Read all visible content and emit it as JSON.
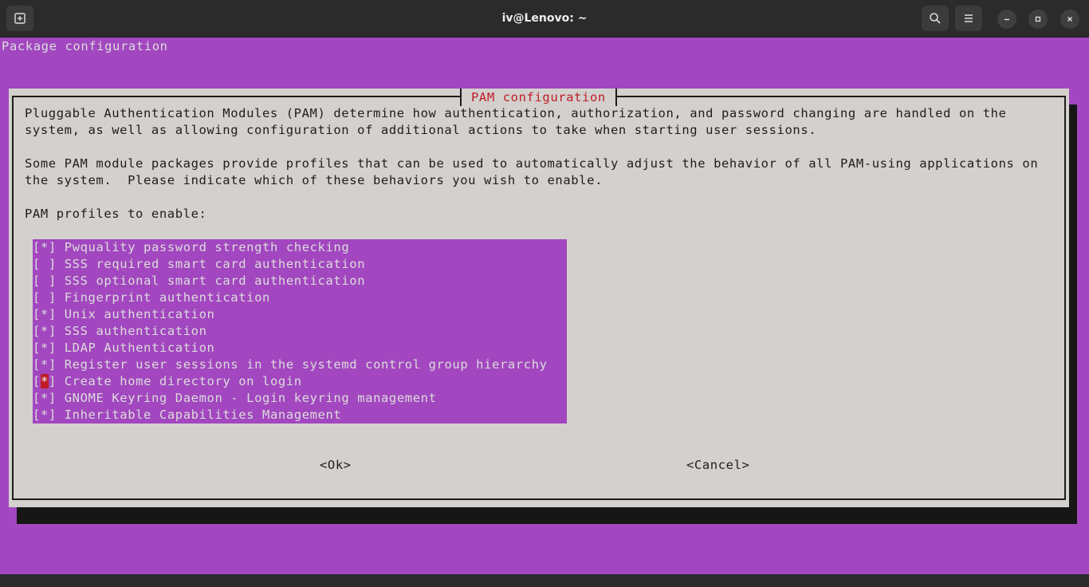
{
  "window": {
    "title": "iv@Lenovo: ~",
    "icons": [
      "new-tab-icon",
      "search-icon",
      "hamburger-menu-icon",
      "minimize-icon",
      "maximize-icon",
      "close-icon"
    ]
  },
  "terminal": {
    "header": "Package configuration",
    "colors": {
      "background": "#a247bf",
      "dialog": "#d3d0cd",
      "title": "#c01c28",
      "cursor": "#c01c28"
    }
  },
  "dialog": {
    "title": "PAM configuration",
    "para1_line1": "Pluggable Authentication Modules (PAM) determine how authentication, authorization, and password changing are handled on the",
    "para1_line2": "system, as well as allowing configuration of additional actions to take when starting user sessions.",
    "para2_line1": "Some PAM module packages provide profiles that can be used to automatically adjust the behavior of all PAM-using applications on",
    "para2_line2": "the system.  Please indicate which of these behaviors you wish to enable.",
    "prompt": "PAM profiles to enable:",
    "items": [
      {
        "label": "Pwquality password strength checking",
        "checked": true
      },
      {
        "label": "SSS required smart card authentication",
        "checked": false
      },
      {
        "label": "SSS optional smart card authentication",
        "checked": false
      },
      {
        "label": "Fingerprint authentication",
        "checked": false
      },
      {
        "label": "Unix authentication",
        "checked": true
      },
      {
        "label": "SSS authentication",
        "checked": true
      },
      {
        "label": "LDAP Authentication",
        "checked": true
      },
      {
        "label": "Register user sessions in the systemd control group hierarchy",
        "checked": true
      },
      {
        "label": "Create home directory on login",
        "checked": true,
        "cursor": true
      },
      {
        "label": "GNOME Keyring Daemon - Login keyring management",
        "checked": true
      },
      {
        "label": "Inheritable Capabilities Management",
        "checked": true
      }
    ],
    "ok_label": "<Ok>",
    "cancel_label": "<Cancel>"
  }
}
